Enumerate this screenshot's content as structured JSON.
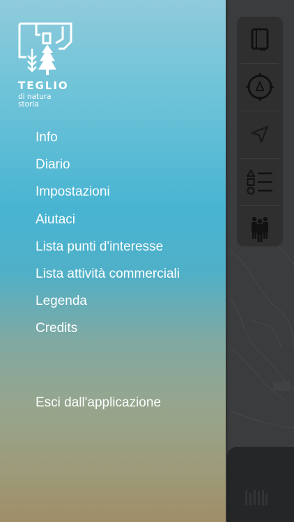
{
  "logo": {
    "title": "TEGLIO",
    "subtitle_line1": "di natura",
    "subtitle_line2": "storia",
    "icon": "teglio-logo-icon"
  },
  "menu": {
    "items": [
      {
        "label": "Info"
      },
      {
        "label": "Diario"
      },
      {
        "label": "Impostazioni"
      },
      {
        "label": "Aiutaci"
      },
      {
        "label": "Lista punti d'interesse"
      },
      {
        "label": "Lista attività commerciali"
      },
      {
        "label": "Legenda"
      },
      {
        "label": "Credits"
      }
    ],
    "exit_label": "Esci dall'applicazione"
  },
  "map_toolbar": {
    "tools": [
      "notebook-icon",
      "compass-icon",
      "location-arrow-icon",
      "legend-shapes-icon",
      "group-people-icon"
    ]
  },
  "colors": {
    "drawer_top": "#8fcbdc",
    "drawer_mid": "#48b4d2",
    "drawer_bottom": "#a08e68",
    "menu_text": "#ffffff"
  }
}
